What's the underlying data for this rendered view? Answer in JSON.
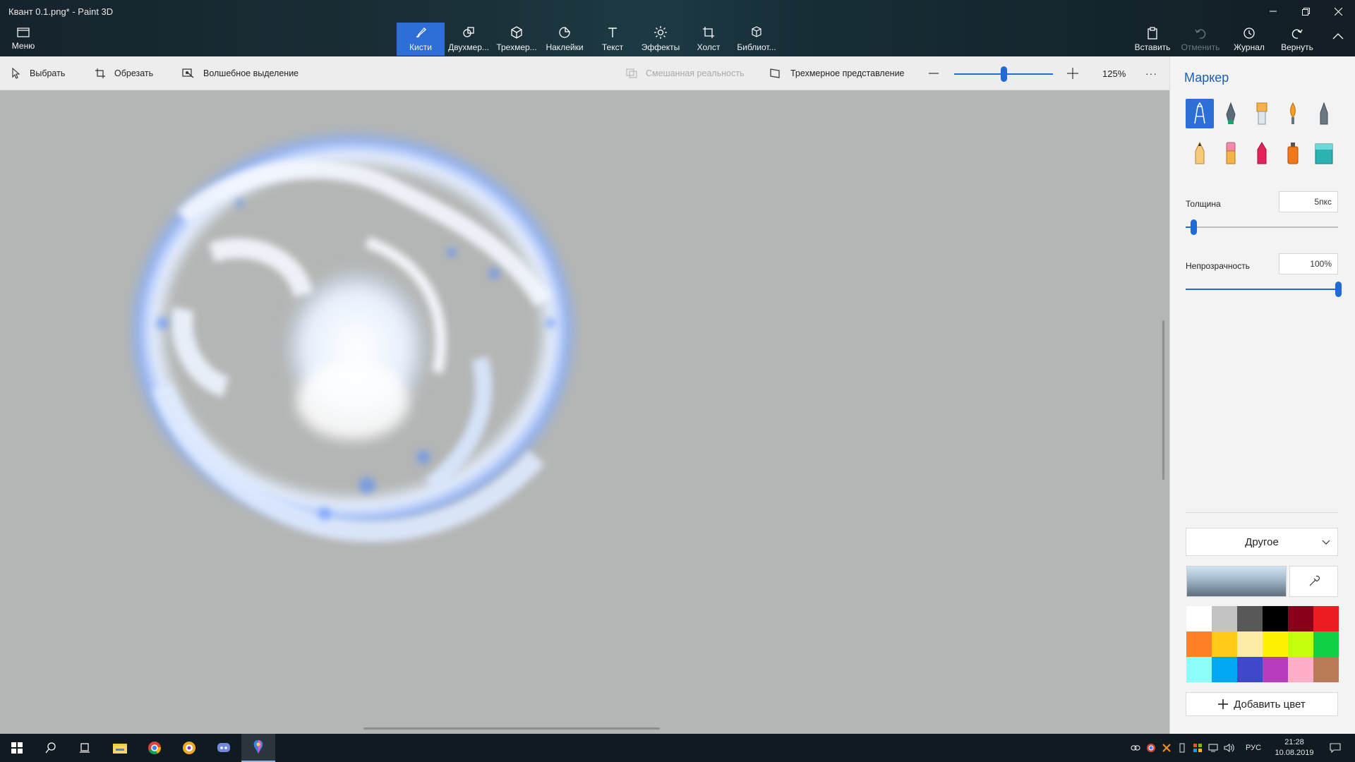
{
  "app": {
    "title": "Квант  0.1.png* - Paint 3D"
  },
  "window_controls": {
    "minimize": "minimize",
    "maximize": "restore",
    "close": "close"
  },
  "ribbon": {
    "menu_label": "Меню",
    "tabs": [
      {
        "label": "Кисти",
        "icon": "brush-icon",
        "active": true
      },
      {
        "label": "Двухмер...",
        "icon": "2d-shapes-icon"
      },
      {
        "label": "Трехмер...",
        "icon": "3d-shapes-icon"
      },
      {
        "label": "Наклейки",
        "icon": "stickers-icon"
      },
      {
        "label": "Текст",
        "icon": "text-icon"
      },
      {
        "label": "Эффекты",
        "icon": "effects-icon"
      },
      {
        "label": "Холст",
        "icon": "canvas-icon"
      },
      {
        "label": "Библиот...",
        "icon": "library-icon"
      }
    ],
    "right": {
      "paste": "Вставить",
      "undo": "Отменить",
      "history": "Журнал",
      "redo": "Вернуть"
    }
  },
  "toolbar": {
    "select": "Выбрать",
    "crop": "Обрезать",
    "magic_select": "Волшебное выделение",
    "mixed_reality": "Смешанная реальность",
    "view_3d": "Трехмерное представление",
    "zoom": "125%",
    "zoom_level": 0.5,
    "more": "···"
  },
  "panel": {
    "title": "Маркер",
    "brushes": [
      "marker",
      "calligraphy-pen",
      "oil-brush",
      "watercolor",
      "pixel-pen",
      "pencil",
      "eraser",
      "crayon",
      "spray-can",
      "fill"
    ],
    "selected_brush": "marker",
    "thickness_label": "Толщина",
    "thickness_value": "5пкс",
    "thickness_level": 0.05,
    "opacity_label": "Непрозрачность",
    "opacity_value": "100%",
    "opacity_level": 1.0,
    "other_label": "Другое",
    "add_color": "Добавить цвет",
    "palette": [
      "#ffffff",
      "#c3c3c3",
      "#585858",
      "#000000",
      "#88001b",
      "#ec1c24",
      "#ff7f27",
      "#ffca18",
      "#fdeca6",
      "#fff200",
      "#c4ff0e",
      "#0ed145",
      "#8cfffb",
      "#00a8f3",
      "#3f48cc",
      "#b83dba",
      "#ffaec8",
      "#b97a56"
    ]
  },
  "taskbar": {
    "lang": "РУС",
    "time": "21:28",
    "date": "10.08.2019"
  }
}
